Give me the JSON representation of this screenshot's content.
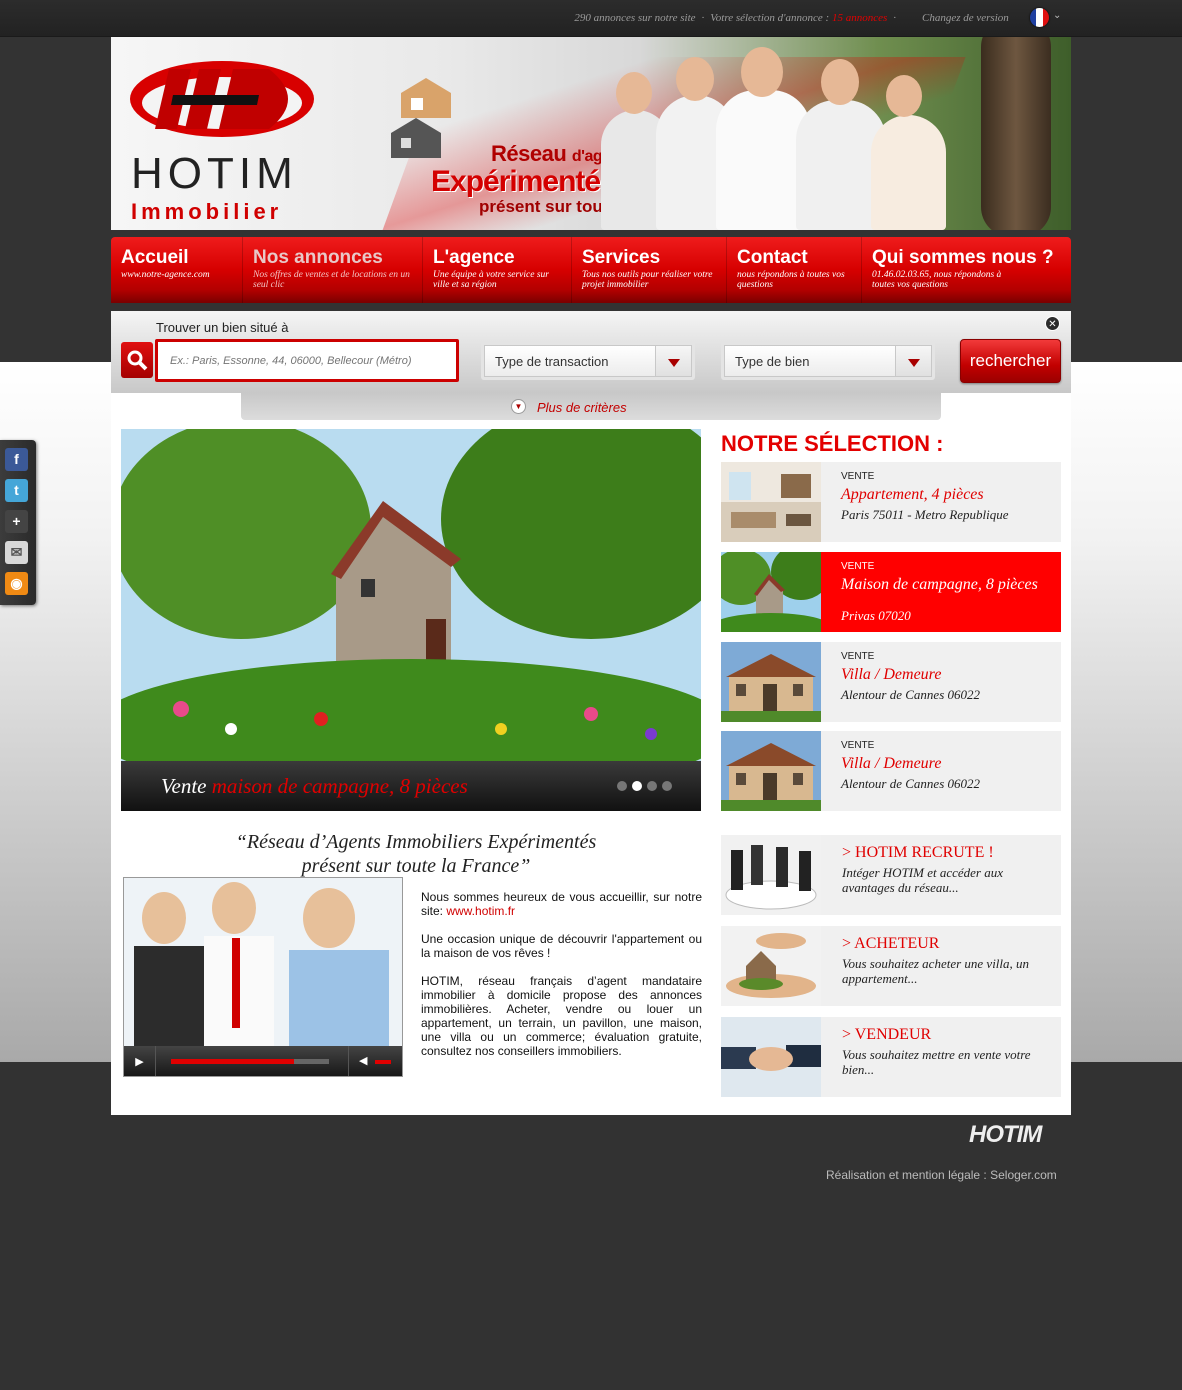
{
  "topbar": {
    "annonces_count_text": "290 annonces sur notre site",
    "selection_label": "Votre sélection d'annonce :",
    "selection_count": "15 annonces",
    "version_label": "Changez de version",
    "flag_colors": [
      "#1f3fa0",
      "#ffffff",
      "#e01010"
    ]
  },
  "banner": {
    "logo_word1": "HOTIM",
    "logo_word2": "Immobilier",
    "slogan_line1_a": "Réseau",
    "slogan_line1_b": "d'agents immobiliers",
    "slogan_line2": "Expérimentés",
    "slogan_line3": "présent sur toute la France !"
  },
  "nav": [
    {
      "title": "Accueil",
      "subtitle": "www.notre-agence.com",
      "active": false
    },
    {
      "title": "Nos annonces",
      "subtitle": "Nos offres de ventes et  de locations en un seul clic",
      "active": true
    },
    {
      "title": "L'agence",
      "subtitle": "Une équipe à votre service sur ville et sa région",
      "active": false
    },
    {
      "title": "Services",
      "subtitle": "Tous nos outils pour réaliser votre projet immobilier",
      "active": false
    },
    {
      "title": "Contact",
      "subtitle": "nous répondons à toutes vos questions",
      "active": false
    },
    {
      "title": "Qui sommes nous ?",
      "subtitle": "01.46.02.03.65, nous répondons à toutes vos questions",
      "active": false
    }
  ],
  "search": {
    "label": "Trouver un bien situé à",
    "placeholder": "Ex.: Paris, Essonne, 44, 06000, Bellecour (Métro)",
    "transaction_select": "Type de transaction",
    "bien_select": "Type de bien",
    "button": "rechercher",
    "more_criteria": "Plus de critères"
  },
  "slider": {
    "caption_a": "Vente",
    "caption_b": "maison de campagne, 8 pièces",
    "active_dot": 1
  },
  "quote": {
    "line1": "“Réseau d’Agents Immobiliers Expérimentés",
    "line2": "présent sur toute la France”"
  },
  "video": {
    "progress": 0.78
  },
  "intro": {
    "p1_text": "Nous sommes heureux de vous accueillir, sur notre site: ",
    "p1_link": "www.hotim.fr",
    "p2": "Une occasion unique de découvrir l'appartement ou la maison de vos rêves !",
    "p3": "HOTIM, réseau français d’agent mandataire immobilier à domicile propose des annonces immobilières. Acheter, vendre ou louer un appartement, un terrain, un pavillon, une maison, une villa ou un commerce; évaluation gratuite, consultez nos conseillers immobiliers."
  },
  "selection": {
    "title": "NOTRE SÉLECTION :",
    "items": [
      {
        "kind": "VENTE",
        "name": "Appartement, 4 pièces",
        "place": "Paris 75011 - Metro Republique"
      },
      {
        "kind": "VENTE",
        "name": "Maison de campagne, 8 pièces",
        "place": "Privas 07020"
      },
      {
        "kind": "VENTE",
        "name": "Villa / Demeure",
        "place": "Alentour de Cannes 06022"
      },
      {
        "kind": "VENTE",
        "name": "Villa / Demeure",
        "place": "Alentour de Cannes 06022"
      }
    ]
  },
  "promos": [
    {
      "title": "> HOTIM RECRUTE !",
      "desc": "Intéger HOTIM et accéder aux avantages du réseau..."
    },
    {
      "title": "> ACHETEUR",
      "desc": "Vous souhaitez acheter une villa, un appartement..."
    },
    {
      "title": "> VENDEUR",
      "desc": "Vous souhaitez mettre en vente votre bien..."
    }
  ],
  "social": [
    {
      "icon": "facebook-icon",
      "glyph": "f",
      "color": "#3b5998"
    },
    {
      "icon": "twitter-icon",
      "glyph": "t",
      "color": "#45a6d8"
    },
    {
      "icon": "google-plus-icon",
      "glyph": "+",
      "color": "#444444"
    },
    {
      "icon": "mail-icon",
      "glyph": "✉",
      "color": "#d8d8d8"
    },
    {
      "icon": "rss-icon",
      "glyph": "◉",
      "color": "#f08a14"
    }
  ],
  "footer": {
    "brand": "HOTIM",
    "legal": "Réalisation et mention légale : Seloger.com"
  },
  "colors": {
    "accent": "#e00000",
    "dark": "#303030"
  }
}
